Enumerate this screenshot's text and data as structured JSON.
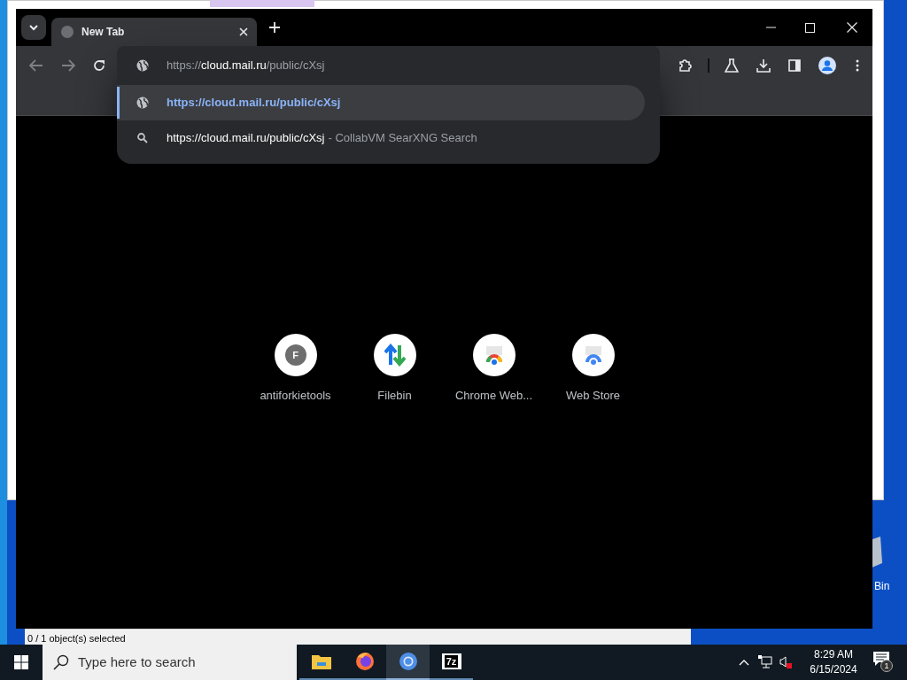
{
  "background_window": {
    "status_text": "0 / 1 object(s) selected"
  },
  "desktop": {
    "recycle_bin_label": "Bin"
  },
  "browser": {
    "tabs": [
      {
        "title": "New Tab",
        "selected": true
      }
    ],
    "omnibox": {
      "scheme": "https://",
      "host": "cloud.mail.ru",
      "path": "/public/cXsj"
    },
    "suggestions": [
      {
        "kind": "url",
        "text": "https://cloud.mail.ru/public/cXsj",
        "selected": true
      },
      {
        "kind": "search",
        "text": "https://cloud.mail.ru/public/cXsj",
        "detail": "- CollabVM SearXNG Search",
        "selected": false
      }
    ],
    "shortcuts": [
      {
        "kind": "letter",
        "letter": "F",
        "title": "antiforkietools"
      },
      {
        "kind": "arrows",
        "title": "Filebin"
      },
      {
        "kind": "rainbow",
        "title": "Chrome Web..."
      },
      {
        "kind": "store",
        "title": "Web Store"
      }
    ]
  },
  "taskbar": {
    "search_placeholder": "Type here to search",
    "apps": [
      {
        "kind": "folder",
        "active": false
      },
      {
        "kind": "firefox",
        "active": false
      },
      {
        "kind": "chromium",
        "active": true
      },
      {
        "kind": "archive",
        "label": "7z",
        "active": false
      }
    ],
    "time": "8:29 AM",
    "date": "6/15/2024",
    "notification_count": "1"
  }
}
